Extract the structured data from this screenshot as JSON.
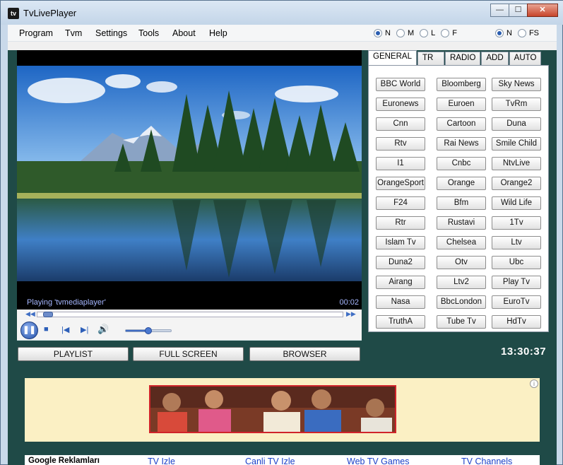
{
  "window": {
    "title": "TvLivePlayer",
    "icon_text": "tv",
    "minimize_label": "—",
    "maximize_label": "☐",
    "close_label": "✕"
  },
  "menu": {
    "items": [
      "Program",
      "Tvm",
      "Settings",
      "Tools",
      "About",
      "Help"
    ],
    "size_options": [
      {
        "label": "N",
        "checked": true
      },
      {
        "label": "M",
        "checked": false
      },
      {
        "label": "L",
        "checked": false
      },
      {
        "label": "F",
        "checked": false
      }
    ],
    "screen_options": [
      {
        "label": "N",
        "checked": true
      },
      {
        "label": "FS",
        "checked": false
      }
    ]
  },
  "player": {
    "status_text": "Playing 'tvmediaplayer'",
    "time": "00:02",
    "seek_progress": 0.02,
    "volume": 0.5
  },
  "actions": {
    "playlist": "PLAYLIST",
    "fullscreen": "FULL SCREEN",
    "browser": "BROWSER"
  },
  "clock": "13:30:37",
  "tabs": [
    {
      "label": "GENERAL",
      "active": true
    },
    {
      "label": "TR",
      "active": false
    },
    {
      "label": "RADIO",
      "active": false
    },
    {
      "label": "ADD",
      "active": false
    },
    {
      "label": "AUTO",
      "active": false
    }
  ],
  "channels": [
    [
      "BBC World",
      "Bloomberg",
      "Sky News"
    ],
    [
      "Euronews",
      "Euroen",
      "TvRm"
    ],
    [
      "Cnn",
      "Cartoon",
      "Duna"
    ],
    [
      "Rtv",
      "Rai News",
      "Smile Child"
    ],
    [
      "I1",
      "Cnbc",
      "NtvLive"
    ],
    [
      "OrangeSport",
      "Orange",
      "Orange2"
    ],
    [
      "F24",
      "Bfm",
      "Wild Life"
    ],
    [
      "Rtr",
      "Rustavi",
      "1Tv"
    ],
    [
      "Islam Tv",
      "Chelsea",
      "Ltv"
    ],
    [
      "Duna2",
      "Otv",
      "Ubc"
    ],
    [
      "Airang",
      "Ltv2",
      "Play Tv"
    ],
    [
      "Nasa",
      "BbcLondon",
      "EuroTv"
    ],
    [
      "TruthA",
      "Tube Tv",
      "HdTv"
    ]
  ],
  "ads": {
    "info_label": "i",
    "links_title": "Google Reklamları",
    "links": [
      "TV Izle",
      "Canli TV Izle",
      "Web TV Games",
      "TV Channels"
    ]
  },
  "colors": {
    "client_bg": "#1f4a47",
    "accent": "#3d6bc3",
    "ad_bg": "#fbf0c4"
  }
}
